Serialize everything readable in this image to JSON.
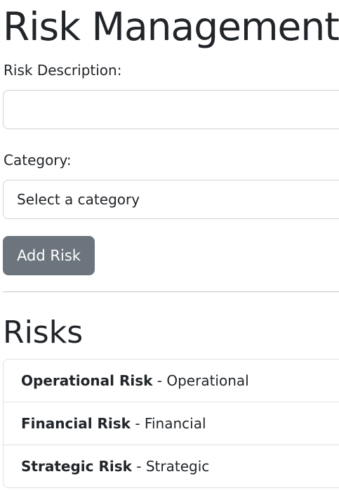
{
  "page": {
    "title": "Risk Management"
  },
  "form": {
    "description_label": "Risk Description:",
    "description_value": "",
    "category_label": "Category:",
    "category_selected": "Select a category",
    "add_button_label": "Add Risk"
  },
  "risks": {
    "heading": "Risks",
    "separator": " - ",
    "items": [
      {
        "name": "Operational Risk",
        "category": "Operational"
      },
      {
        "name": "Financial Risk",
        "category": "Financial"
      },
      {
        "name": "Strategic Risk",
        "category": "Strategic"
      }
    ]
  },
  "colors": {
    "button_bg": "#6c757d",
    "text": "#212529",
    "border": "#ced4da"
  }
}
